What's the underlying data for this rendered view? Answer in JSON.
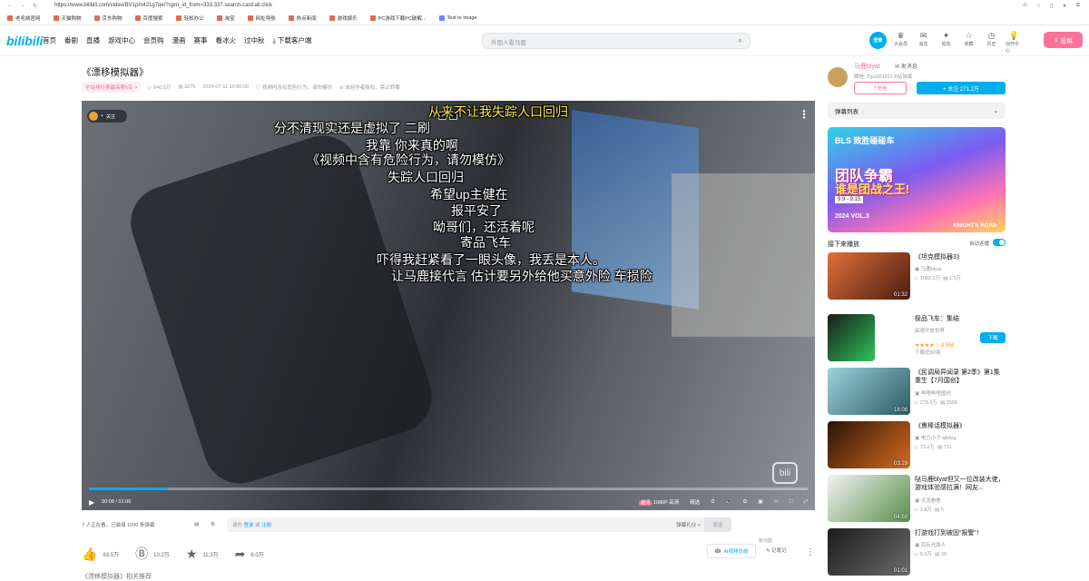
{
  "browser": {
    "url": "https://www.bilibili.com/video/BV1pm421g7qe/?spm_id_from=333.337.search-card.all.click"
  },
  "bookmarks": [
    "老毛桃官网",
    "天猫购物",
    "京东购物",
    "百度搜索",
    "轻松办公",
    "淘宝",
    "网址导航",
    "热点新闻",
    "游戏娱乐",
    "PC游戏下载PC破解...",
    "Text to Image"
  ],
  "header": {
    "logo": "bilibili",
    "nav": [
      "首页",
      "番剧",
      "直播",
      "游戏中心",
      "会员购",
      "漫画",
      "赛事",
      "看冰火",
      "过中秋",
      "下载客户端"
    ],
    "search_placeholder": "外国人看马鹿",
    "avatar_text": "登录",
    "icons": [
      {
        "label": "大会员",
        "icon": "vip-icon"
      },
      {
        "label": "消息",
        "icon": "message-icon"
      },
      {
        "label": "动态",
        "icon": "dynamic-icon"
      },
      {
        "label": "收藏",
        "icon": "favorite-icon"
      },
      {
        "label": "历史",
        "icon": "history-icon"
      },
      {
        "label": "创作中心",
        "icon": "creator-icon"
      }
    ],
    "upload": "投稿"
  },
  "video": {
    "title": "《漂移模拟器》",
    "badge": "全站排行榜最高第6名 >",
    "views": "640.5万",
    "danmaku_count": "3279",
    "date": "2024-07-11 10:00:00",
    "warning1": "视频内含有危险行为，请勿模仿",
    "warning2": "未经作者授权，禁止转载"
  },
  "player": {
    "follow_chip": "关注",
    "time": "00:08 / 01:06",
    "progress": 0.11,
    "quality": "1080P 高清",
    "quality_badge": "超清",
    "select": "精选",
    "watermark": "bili",
    "danmaku": [
      {
        "text": "从来不让我失踪人口回归",
        "color": "yellow"
      },
      {
        "text": "分不清现实还是虚拟了 二刷",
        "color": "white"
      },
      {
        "text": "我靠  你来真的啊",
        "color": "white"
      },
      {
        "text": "《视频中含有危险行为，请勿模仿》",
        "color": "white"
      },
      {
        "text": "失踪人口回归",
        "color": "white"
      },
      {
        "text": "希望up主健在",
        "color": "white"
      },
      {
        "text": "报平安了",
        "color": "white"
      },
      {
        "text": "呦哥们，还活着呢",
        "color": "white"
      },
      {
        "text": "寄品飞车",
        "color": "white"
      },
      {
        "text": "吓得我赶紧看了一眼头像，我丢是本人。",
        "color": "white"
      },
      {
        "text": "让马鹿接代言  估计要另外给他买意外险  车损险",
        "color": "white"
      }
    ]
  },
  "under_player": {
    "watching": "7 人正在看，已装填 1000 条弹幕",
    "input_prefix": "请先",
    "login": "登录",
    "or": "或",
    "register": "注册",
    "etiquette": "弹幕礼仪 >",
    "send": "发送"
  },
  "toolbar": {
    "like": "63.5万",
    "coin": "10.2万",
    "favorite": "11.3万",
    "share": "6.0万",
    "ai_summary": "AI视频总结",
    "note": "记笔记",
    "new_tag": "新功能"
  },
  "below_title": "《漂移模拟器》相关推荐",
  "uploader": {
    "name": "马鹿blyat",
    "message": "发消息",
    "desc": "微信: Ziyu001221 B站独家",
    "charge": "充电",
    "follow": "+ 关注 271.2万"
  },
  "sidebar": {
    "danmaku_list": "弹幕列表",
    "banner": {
      "brand": "BLS 致胜碰碰车",
      "line1": "团队争霸",
      "line2": "谁是团战之王!",
      "date": "9.9 - 9.15",
      "vol": "2024 VOL.3",
      "road": "KNIGHT'S ROAD"
    },
    "next_label": "接下来播放",
    "autoplay": "自动连播",
    "recs": [
      {
        "title": "《坦克模拟器3》",
        "author": "马鹿blyat",
        "views": "1092.2万",
        "danmaku": "1.3万",
        "duration": "01:32",
        "bg": "#b44a2a"
      },
      {
        "title": "极品飞车：集结",
        "author": "高速开放世界",
        "rating": "8.9分",
        "downloads": "下载近50强",
        "ad": "下载",
        "bg": "#1a6b3a"
      },
      {
        "title": "《民调局异闻录 第2季》第1集 重生【7月国创】",
        "author": "哔哩哔哩国创",
        "views": "279.5万",
        "danmaku": "2595",
        "duration": "18:08",
        "bg": "#4a8a96"
      },
      {
        "title": "《熏棒话模拟器》",
        "author": "电力小子-qfeleg",
        "views": "73.2万",
        "danmaku": "711",
        "duration": "03:29",
        "bg": "#7a3010"
      },
      {
        "title": "哒马鹿blyat但又一位改装大佬，游戏体验感拉满！网友...",
        "author": "天龙看看",
        "views": "1.8万",
        "danmaku": "5",
        "duration": "04:58",
        "bg": "#5a8f4a"
      },
      {
        "title": "打游戏打到被固“报警”！",
        "author": "百玩光路人",
        "views": "8.9万",
        "danmaku": "30",
        "duration": "01:01",
        "bg": "#3a3a3a"
      }
    ]
  }
}
